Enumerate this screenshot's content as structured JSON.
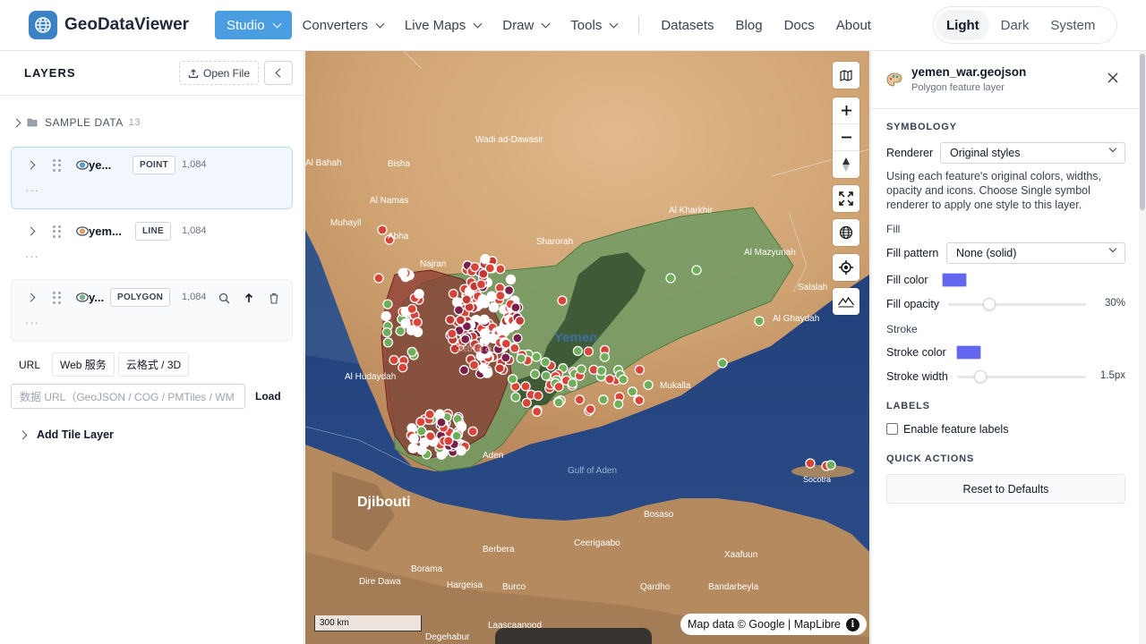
{
  "app": {
    "name": "GeoDataViewer"
  },
  "nav": {
    "items": [
      {
        "label": "Studio",
        "dropdown": true,
        "active": true
      },
      {
        "label": "Converters",
        "dropdown": true
      },
      {
        "label": "Live Maps",
        "dropdown": true
      },
      {
        "label": "Draw",
        "dropdown": true
      },
      {
        "label": "Tools",
        "dropdown": true
      }
    ],
    "links": [
      "Datasets",
      "Blog",
      "Docs",
      "About"
    ]
  },
  "theme": {
    "options": [
      "Light",
      "Dark",
      "System"
    ],
    "selected": "Light"
  },
  "layers_panel": {
    "title": "LAYERS",
    "open_file": "Open File",
    "sample_group": {
      "label": "SAMPLE DATA",
      "count": "13"
    },
    "layers": [
      {
        "name": "ye...",
        "type": "POINT",
        "count": "1,084",
        "more": "···"
      },
      {
        "name": "yem...",
        "type": "LINE",
        "count": "1,084",
        "more": "···"
      },
      {
        "name": "y...",
        "type": "POLYGON",
        "count": "1,084",
        "more": "···"
      }
    ],
    "source_tabs": [
      "URL",
      "Web 服务",
      "云格式 / 3D"
    ],
    "url_placeholder": "数据 URL（GeoJSON / COG / PMTiles / WM",
    "load_label": "Load",
    "add_tile_layer": "Add Tile Layer"
  },
  "map": {
    "place_labels": [
      "Wadi ad-Dawasir",
      "Al Bahah",
      "Bisha",
      "Al Namas",
      "Muhayil",
      "Abha",
      "Najran",
      "Sharorah",
      "Al Kharkhir",
      "Al Mazyunah",
      "Salalah",
      "Al Ghaydah",
      "Yemen",
      "Al Hudaydah",
      "Mukalla",
      "Sana'a",
      "Gulf of Aden",
      "Aden",
      "Djibouti",
      "Bosaso",
      "Ceerigaabo",
      "Berbera",
      "Xaafuun",
      "Dire Dawa",
      "Borama",
      "Hargeisa",
      "Burco",
      "Qardho",
      "Bandarbeyla",
      "Laascaanood",
      "Degehabur",
      "Socotra"
    ],
    "scale_label": "300 km",
    "attribution": "Map data © Google | MapLibre"
  },
  "props_panel": {
    "layer_name": "yemen_war.geojson",
    "layer_subtitle": "Polygon feature layer",
    "symbology": {
      "title": "SYMBOLOGY",
      "renderer_label": "Renderer",
      "renderer_value": "Original styles",
      "description": "Using each feature's original colors, widths, opacity and icons. Choose Single symbol renderer to apply one style to this layer."
    },
    "fill": {
      "title": "Fill",
      "pattern_label": "Fill pattern",
      "pattern_value": "None (solid)",
      "color_label": "Fill color",
      "color": "#6366f1",
      "opacity_label": "Fill opacity",
      "opacity_value": "30%",
      "opacity_fraction": 0.3
    },
    "stroke": {
      "title": "Stroke",
      "color_label": "Stroke color",
      "color": "#6366f1",
      "width_label": "Stroke width",
      "width_value": "1.5px"
    },
    "labels": {
      "title": "LABELS",
      "enable_label": "Enable feature labels",
      "checked": false
    },
    "quick_actions": {
      "title": "QUICK ACTIONS",
      "reset_label": "Reset to Defaults"
    }
  }
}
